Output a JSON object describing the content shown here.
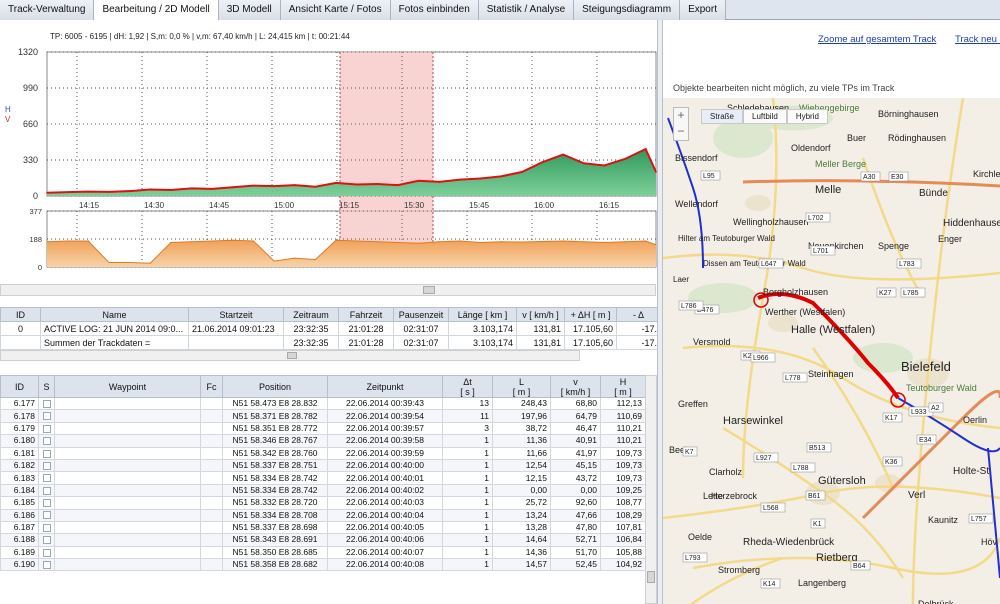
{
  "tabs": [
    "Track-Verwaltung",
    "Bearbeitung / 2D Modell",
    "3D Modell",
    "Ansicht Karte / Fotos",
    "Fotos einbinden",
    "Statistik / Analyse",
    "Steigungsdiagramm",
    "Export"
  ],
  "active_tab": 1,
  "info_line": "TP: 6005 - 6195 | dH: 1,92  | S,m: 0,0 % | v,m: 67,40 km/h | L: 24,415 km | t: 00:21:44",
  "chart_data": [
    {
      "type": "area",
      "y_axis_label_h": "H",
      "y_axis_label_v": "V",
      "y_ticks": [
        "1320",
        "990",
        "660",
        "330",
        "0"
      ],
      "ylim": [
        0,
        1320
      ],
      "x_ticks": [
        "14:15",
        "14:30",
        "14:45",
        "15:00",
        "15:15",
        "15:30",
        "15:45",
        "16:00",
        "16:15"
      ],
      "x": [
        0,
        4,
        8,
        12,
        16,
        20,
        24,
        28,
        32,
        36,
        40,
        44,
        48,
        52,
        56,
        60,
        64,
        68,
        72,
        76,
        80,
        84,
        88,
        92,
        96,
        100,
        104,
        108,
        112,
        116,
        118
      ],
      "values": [
        30,
        35,
        40,
        38,
        45,
        60,
        55,
        70,
        65,
        80,
        95,
        90,
        100,
        85,
        120,
        105,
        110,
        100,
        140,
        130,
        150,
        160,
        180,
        220,
        310,
        380,
        300,
        280,
        340,
        430,
        220
      ],
      "highlight_range": [
        "15:15",
        "15:33"
      ],
      "grid": true
    },
    {
      "type": "area",
      "y_ticks": [
        "377",
        "188",
        "0"
      ],
      "ylim": [
        0,
        377
      ],
      "x": [
        0,
        4,
        8,
        12,
        16,
        20,
        24,
        28,
        32,
        36,
        40,
        44,
        48,
        52,
        56,
        60,
        64,
        68,
        72,
        76,
        80,
        84,
        88,
        92,
        96,
        100,
        104,
        108,
        112,
        116,
        118
      ],
      "values": [
        170,
        175,
        175,
        30,
        30,
        25,
        165,
        170,
        175,
        180,
        175,
        40,
        60,
        50,
        180,
        175,
        170,
        165,
        160,
        170,
        175,
        165,
        170,
        168,
        172,
        175,
        170,
        165,
        170,
        175,
        150
      ],
      "grid": true
    }
  ],
  "summary_table": {
    "headers": [
      "ID",
      "Name",
      "Startzeit",
      "Zeitraum",
      "Fahrzeit",
      "Pausenzeit",
      "Länge  [ km ]",
      "v  [ km/h ]",
      "+ ΔH  [ m ]",
      "- Δ"
    ],
    "rows": [
      [
        "0",
        "ACTIVE LOG: 21 JUN 2014 09:0...",
        "21.06.2014 09:01:23",
        "23:32:35",
        "21:01:28",
        "02:31:07",
        "3.103,174",
        "131,81",
        "17.105,60",
        "-17."
      ],
      [
        "",
        "Summen der Trackdaten =",
        "",
        "23:32:35",
        "21:01:28",
        "02:31:07",
        "3.103,174",
        "131,81",
        "17.105,60",
        "-17."
      ]
    ]
  },
  "waypoint_table": {
    "headers": [
      "ID",
      "S",
      "Waypoint",
      "Fc",
      "Position",
      "Zeitpunkt",
      "Δt\n[ s ]",
      "L\n[ m ]",
      "v\n[ km/h ]",
      "H\n[ m ]"
    ],
    "rows": [
      [
        "6.177",
        "N51 58.473 E8 28.832",
        "22.06.2014 00:39:43",
        "13",
        "248,43",
        "68,80",
        "112,13"
      ],
      [
        "6.178",
        "N51 58.371 E8 28.782",
        "22.06.2014 00:39:54",
        "11",
        "197,96",
        "64,79",
        "110,69"
      ],
      [
        "6.179",
        "N51 58.351 E8 28.772",
        "22.06.2014 00:39:57",
        "3",
        "38,72",
        "46,47",
        "110,21"
      ],
      [
        "6.180",
        "N51 58.346 E8 28.767",
        "22.06.2014 00:39:58",
        "1",
        "11,36",
        "40,91",
        "110,21"
      ],
      [
        "6.181",
        "N51 58.342 E8 28.760",
        "22.06.2014 00:39:59",
        "1",
        "11,66",
        "41,97",
        "109,73"
      ],
      [
        "6.182",
        "N51 58.337 E8 28.751",
        "22.06.2014 00:40:00",
        "1",
        "12,54",
        "45,15",
        "109,73"
      ],
      [
        "6.183",
        "N51 58.334 E8 28.742",
        "22.06.2014 00:40:01",
        "1",
        "12,15",
        "43,72",
        "109,73"
      ],
      [
        "6.184",
        "N51 58.334 E8 28.742",
        "22.06.2014 00:40:02",
        "1",
        "0,00",
        "0,00",
        "109,25"
      ],
      [
        "6.185",
        "N51 58.332 E8 28.720",
        "22.06.2014 00:40:03",
        "1",
        "25,72",
        "92,60",
        "108,77"
      ],
      [
        "6.186",
        "N51 58.334 E8 28.708",
        "22.06.2014 00:40:04",
        "1",
        "13,24",
        "47,66",
        "108,29"
      ],
      [
        "6.187",
        "N51 58.337 E8 28.698",
        "22.06.2014 00:40:05",
        "1",
        "13,28",
        "47,80",
        "107,81"
      ],
      [
        "6.188",
        "N51 58.343 E8 28.691",
        "22.06.2014 00:40:06",
        "1",
        "14,64",
        "52,71",
        "106,84"
      ],
      [
        "6.189",
        "N51 58.350 E8 28.685",
        "22.06.2014 00:40:07",
        "1",
        "14,36",
        "51,70",
        "105,88"
      ],
      [
        "6.190",
        "N51 58.358 E8 28.682",
        "22.06.2014 00:40:08",
        "1",
        "14,57",
        "52,45",
        "104,92"
      ]
    ]
  },
  "right_panel": {
    "zoom_link": "Zoome auf gesamtem Track",
    "new_track_link": "Track neu la",
    "note": "Objekte bearbeiten nicht möglich, zu viele TPs im Track",
    "map_types": [
      "Straße",
      "Luftbild",
      "Hybrid"
    ],
    "zoom_plus": "+",
    "zoom_minus": "−",
    "map_labels": [
      "Schledehausen",
      "Wiehengebirge",
      "Börninghausen",
      "Rödinghausen",
      "Bissendorf",
      "Oldendorf",
      "Buer",
      "Meller Berge",
      "Melle",
      "Kirchlen",
      "Bünde",
      "Wellendorf",
      "Hiddenhause",
      "Wellingholzhausen",
      "Hilter am Teutoburger Wald",
      "Neuenkirchen",
      "Spenge",
      "Enger",
      "Dissen am Teutoburger Wald",
      "Laer",
      "Borgholzhausen",
      "Werther (Westfalen)",
      "Halle (Westfalen)",
      "Versmold",
      "Bielefeld",
      "Steinhagen",
      "Teutoburger Wald",
      "Greffen",
      "Harsewinkel",
      "Oerlin",
      "Beelen",
      "Clarholz",
      "Herzebrock",
      "Gütersloh",
      "Verl",
      "Holte-St",
      "Kaunitz",
      "Oelde",
      "Rheda-Wiedenbrück",
      "Rietberg",
      "Stromberg",
      "Langenberg",
      "Delbrück",
      "Lette",
      "Höv"
    ],
    "road_labels": [
      "L95",
      "A30",
      "E30",
      "L702",
      "L701",
      "L783",
      "L647",
      "K27",
      "L785",
      "B476",
      "L786",
      "K23",
      "L966",
      "L778",
      "L933",
      "A2",
      "K17",
      "E34",
      "K7",
      "L927",
      "L788",
      "B513",
      "K36",
      "B61",
      "L568",
      "L757",
      "L793",
      "K1",
      "B64",
      "K14"
    ]
  }
}
